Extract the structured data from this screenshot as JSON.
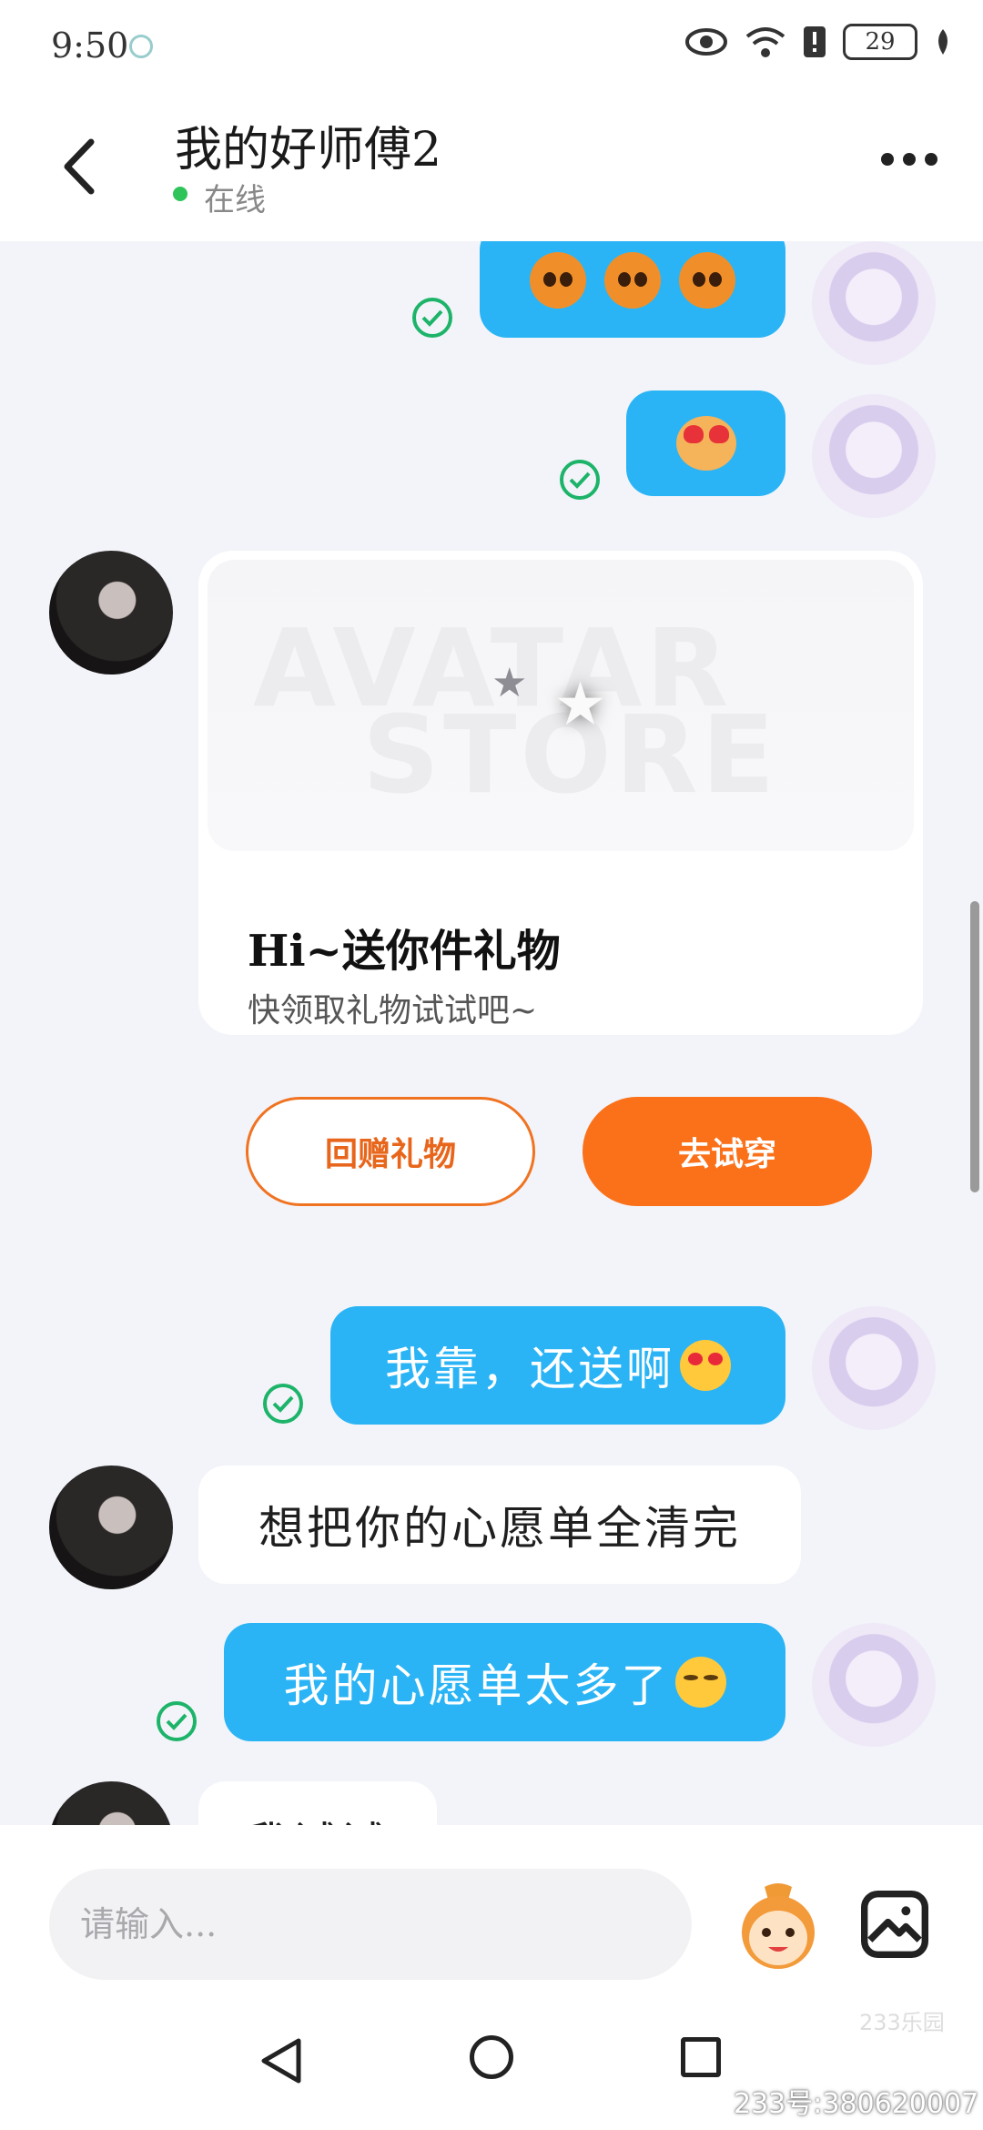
{
  "status_bar": {
    "time": "9:50",
    "battery": "29"
  },
  "header": {
    "title": "我的好师傅2",
    "status": "在线"
  },
  "messages": {
    "me_4": "我靠，还送啊",
    "other_5": "想把你的心愿单全清完",
    "me_6": "我的心愿单太多了",
    "other_7_partial": "我试试"
  },
  "gift_card": {
    "banner_line1": "AVATAR",
    "banner_line2": "STORE",
    "title": "Hi~送你件礼物",
    "subtitle": "快领取礼物试试吧~",
    "return_label": "回赠礼物",
    "tryon_label": "去试穿"
  },
  "input": {
    "placeholder": "请输入..."
  },
  "watermark": {
    "logo": "233乐园",
    "text": "233号:380620007"
  },
  "colors": {
    "accent_blue": "#2ab4f5",
    "accent_orange": "#fa711a",
    "online_green": "#2fc45a",
    "check_green": "#1db46a"
  }
}
